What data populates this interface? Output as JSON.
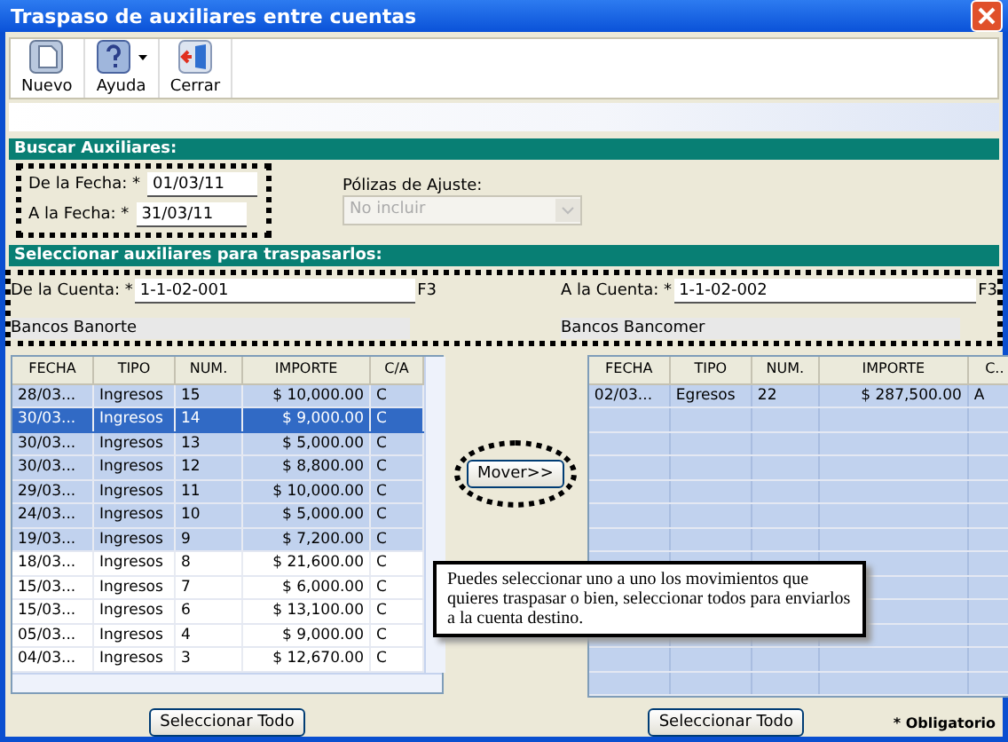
{
  "window": {
    "title": "Traspaso de auxiliares entre cuentas"
  },
  "toolbar": [
    {
      "label": "Nuevo",
      "kind": "new",
      "dropdown": false
    },
    {
      "label": "Ayuda",
      "kind": "help",
      "dropdown": true
    },
    {
      "label": "Cerrar",
      "kind": "close",
      "dropdown": false
    }
  ],
  "search_section": {
    "title": "Buscar Auxiliares:",
    "from_date": {
      "label": "De la Fecha: *",
      "value": "01/03/11"
    },
    "to_date": {
      "label": "A la Fecha: *",
      "value": "31/03/11"
    },
    "adjustments": {
      "label": "Pólizas de Ajuste:",
      "value": "No incluir",
      "disabled": true
    }
  },
  "select_section": {
    "title": "Seleccionar auxiliares para traspasarlos:",
    "from_account": {
      "label": "De la Cuenta: *",
      "value": "1-1-02-001",
      "key": "F3",
      "name": "Bancos Banorte"
    },
    "to_account": {
      "label": "A la Cuenta: *",
      "value": "1-1-02-002",
      "key": "F3",
      "name": "Bancos Bancomer"
    }
  },
  "source_table": {
    "columns": [
      "FECHA",
      "TIPO",
      "NUM.",
      "IMPORTE",
      "C/A"
    ],
    "rows": [
      {
        "cells": [
          "28/03...",
          "Ingresos",
          "15",
          "$ 10,000.00",
          "C"
        ],
        "marked": true,
        "selected": false
      },
      {
        "cells": [
          "30/03...",
          "Ingresos",
          "14",
          "$ 9,000.00",
          "C"
        ],
        "marked": true,
        "selected": true
      },
      {
        "cells": [
          "30/03...",
          "Ingresos",
          "13",
          "$ 5,000.00",
          "C"
        ],
        "marked": true,
        "selected": false
      },
      {
        "cells": [
          "30/03...",
          "Ingresos",
          "12",
          "$ 8,800.00",
          "C"
        ],
        "marked": true,
        "selected": false
      },
      {
        "cells": [
          "29/03...",
          "Ingresos",
          "11",
          "$ 10,000.00",
          "C"
        ],
        "marked": true,
        "selected": false
      },
      {
        "cells": [
          "24/03...",
          "Ingresos",
          "10",
          "$ 5,000.00",
          "C"
        ],
        "marked": true,
        "selected": false
      },
      {
        "cells": [
          "19/03...",
          "Ingresos",
          "9",
          "$ 7,200.00",
          "C"
        ],
        "marked": true,
        "selected": false
      },
      {
        "cells": [
          "18/03...",
          "Ingresos",
          "8",
          "$ 21,600.00",
          "C"
        ],
        "marked": false,
        "selected": false
      },
      {
        "cells": [
          "15/03...",
          "Ingresos",
          "7",
          "$ 6,000.00",
          "C"
        ],
        "marked": false,
        "selected": false
      },
      {
        "cells": [
          "15/03...",
          "Ingresos",
          "6",
          "$ 13,100.00",
          "C"
        ],
        "marked": false,
        "selected": false
      },
      {
        "cells": [
          "05/03...",
          "Ingresos",
          "4",
          "$ 9,000.00",
          "C"
        ],
        "marked": false,
        "selected": false
      },
      {
        "cells": [
          "04/03...",
          "Ingresos",
          "3",
          "$ 12,670.00",
          "C"
        ],
        "marked": false,
        "selected": false
      }
    ]
  },
  "move_button": "Mover>>",
  "target_table": {
    "columns": [
      "FECHA",
      "TIPO",
      "NUM.",
      "IMPORTE",
      "C.."
    ],
    "rows": [
      {
        "cells": [
          "02/03...",
          "Egresos",
          "22",
          "$ 287,500.00",
          "A"
        ],
        "marked": true,
        "selected": false
      }
    ]
  },
  "select_all_buttons": [
    "Seleccionar Todo",
    "Seleccionar Todo"
  ],
  "required_note": "* Obligatorio",
  "callout": "Puedes seleccionar uno a uno los movimientos que quieres traspasar o bien, seleccionar todos para enviarlos a la cuenta destino."
}
